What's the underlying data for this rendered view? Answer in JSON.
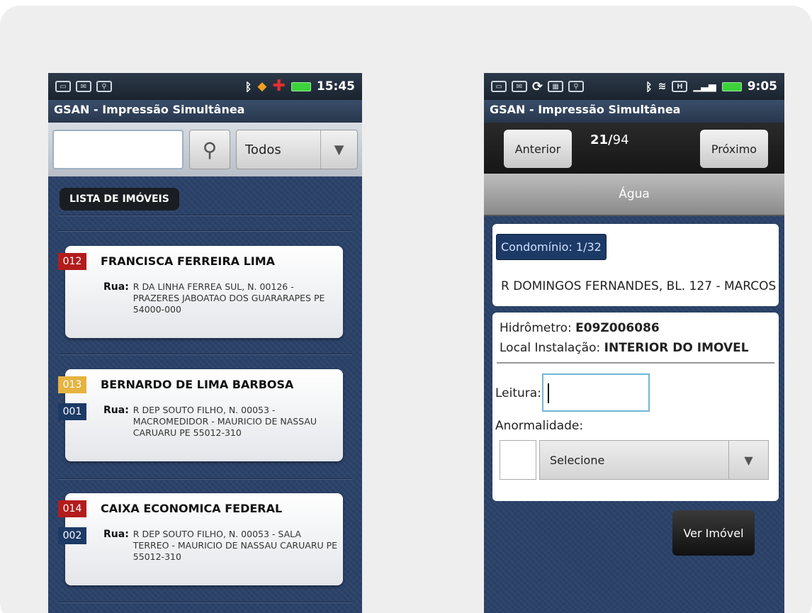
{
  "left_screen": {
    "status_time": "15:45",
    "app_title": "GSAN - Impressão Simultânea",
    "search": {
      "value": "",
      "filter_selected": "Todos"
    },
    "section_label": "LISTA DE IMÓVEIS",
    "properties": [
      {
        "code": "012",
        "code_color": "#b31c1c",
        "subcode": "",
        "name": "FRANCISCA FERREIRA LIMA",
        "addr_label": "Rua:",
        "address": "R DA LINHA FERREA SUL, N. 00126 - PRAZERES JABOATAO DOS GUARARAPES PE 54000-000"
      },
      {
        "code": "013",
        "code_color": "#e6b341",
        "subcode": "001",
        "name": "BERNARDO DE LIMA BARBOSA",
        "addr_label": "Rua:",
        "address": "R DEP SOUTO FILHO, N. 00053 - MACROMEDIDOR - MAURICIO DE NASSAU CARUARU PE 55012-310"
      },
      {
        "code": "014",
        "code_color": "#b31c1c",
        "subcode": "002",
        "name": "CAIXA ECONOMICA FEDERAL",
        "addr_label": "Rua:",
        "address": "R DEP SOUTO FILHO, N. 00053 - SALA TERREO - MAURICIO DE NASSAU CARUARU PE 55012-310"
      }
    ]
  },
  "right_screen": {
    "status_time": "9:05",
    "app_title": "GSAN - Impressão Simultânea",
    "prev_label": "Anterior",
    "next_label": "Próximo",
    "counter_current": "21/",
    "counter_total": "94",
    "tab_label": "Água",
    "condominio_label": "Condomínio: 1/32",
    "address": "R DOMINGOS FERNANDES, BL. 127 - MARCOS",
    "hidrometro_label": "Hidrômetro: ",
    "hidrometro_value": "E09Z006086",
    "local_label": "Local Instalação: ",
    "local_value": "INTERIOR DO IMOVEL",
    "leitura_label": "Leitura:",
    "leitura_value": "",
    "anormalidade_label": "Anormalidade:",
    "anormalidade_selected": "Selecione",
    "ver_imovel_label": "Ver Imóvel"
  }
}
